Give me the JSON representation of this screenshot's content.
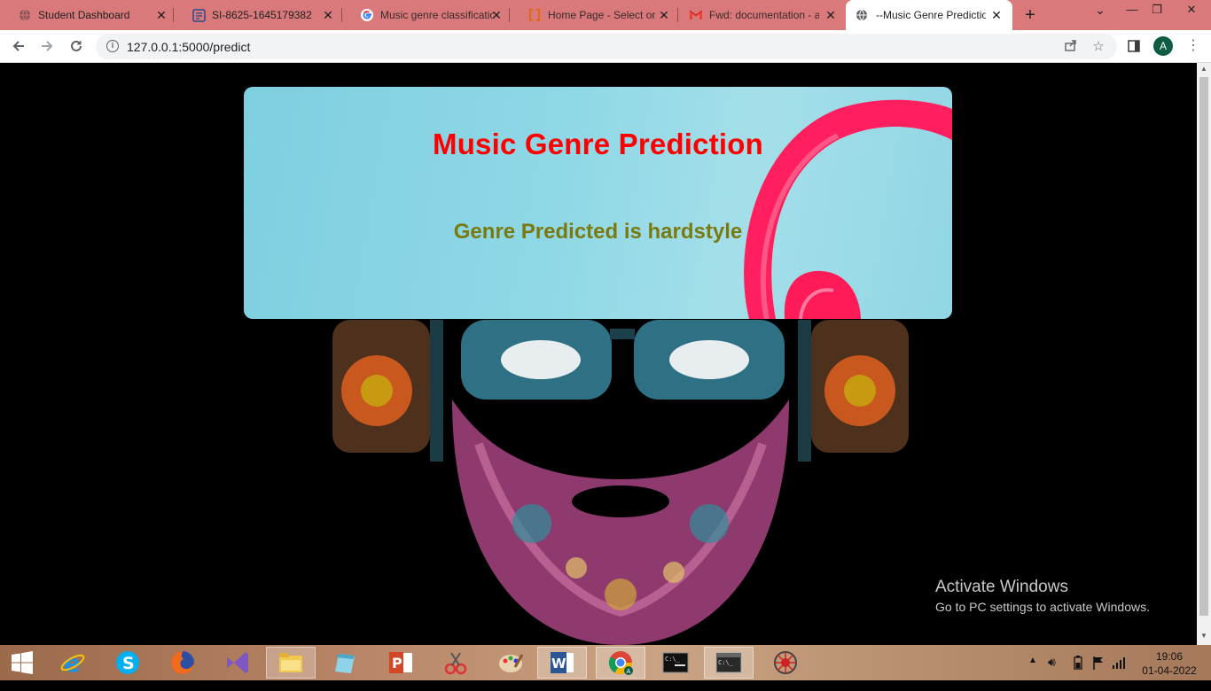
{
  "browser": {
    "tabs": [
      {
        "title": "Student Dashboard",
        "icon": "globe-icon"
      },
      {
        "title": "SI-8625-1645179382",
        "icon": "document-icon"
      },
      {
        "title": "Music genre classificatio",
        "icon": "google-icon"
      },
      {
        "title": "Home Page - Select or c",
        "icon": "bracket-icon"
      },
      {
        "title": "Fwd: documentation - a",
        "icon": "gmail-icon"
      },
      {
        "title": "--Music Genre Predictio",
        "icon": "globe-icon",
        "active": true
      }
    ],
    "new_tab_label": "+",
    "url": "127.0.0.1:5000/predict",
    "profile_initial": "A"
  },
  "page": {
    "heading": "Music Genre Prediction",
    "result_text": "Genre Predicted is hardstyle",
    "heading_color": "#ff0000",
    "result_color": "#7a7a12"
  },
  "watermark": {
    "title": "Activate Windows",
    "subtitle": "Go to PC settings to activate Windows."
  },
  "taskbar": {
    "apps": [
      "windows-start-icon",
      "internet-explorer-icon",
      "skype-icon",
      "firefox-icon",
      "visual-studio-icon",
      "file-explorer-icon",
      "notepad-icon",
      "powerpoint-icon",
      "snipping-tool-icon",
      "paint-icon",
      "word-icon",
      "chrome-icon",
      "terminal-icon",
      "console-icon",
      "network-icon"
    ],
    "time": "19:06",
    "date": "01-04-2022"
  }
}
